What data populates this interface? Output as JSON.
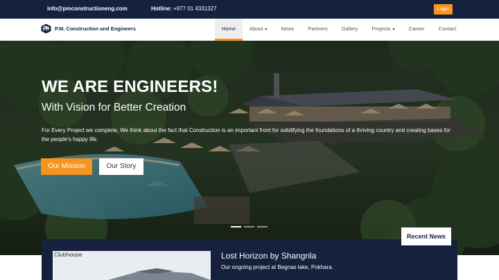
{
  "topbar": {
    "email": "info@pmconstructioneng.com",
    "hotline_label": "Hotline:",
    "hotline_number": "+977 01 4331327",
    "login_label": "Login"
  },
  "navbar": {
    "brand_name": "P.M. Construction and Engineers",
    "items": [
      {
        "label": "Home",
        "active": true,
        "dropdown": false
      },
      {
        "label": "About",
        "active": false,
        "dropdown": true
      },
      {
        "label": "News",
        "active": false,
        "dropdown": false
      },
      {
        "label": "Partners",
        "active": false,
        "dropdown": false
      },
      {
        "label": "Gallery",
        "active": false,
        "dropdown": false
      },
      {
        "label": "Projects",
        "active": false,
        "dropdown": true
      },
      {
        "label": "Career",
        "active": false,
        "dropdown": false
      },
      {
        "label": "Contact",
        "active": false,
        "dropdown": false
      }
    ]
  },
  "hero": {
    "heading": "WE ARE ENGINEERS!",
    "subheading": "With Vision for Better Creation",
    "body": "For Every Project we complete, We think about the fact that Construction is an important front for solidifying the foundations of a thriving country and creating bases for the people's happy life.",
    "primary_button": "Our Mission",
    "secondary_button": "Our Story",
    "slide_count": 3,
    "active_slide": 1
  },
  "news": {
    "section_tag": "Recent News",
    "image_caption": "Clubhouse",
    "title": "Lost Horizon by Shangrila",
    "description": "Our ongoing project at Begnas lake, Pokhara."
  },
  "colors": {
    "navy": "#16213e",
    "accent": "#f7941d"
  }
}
